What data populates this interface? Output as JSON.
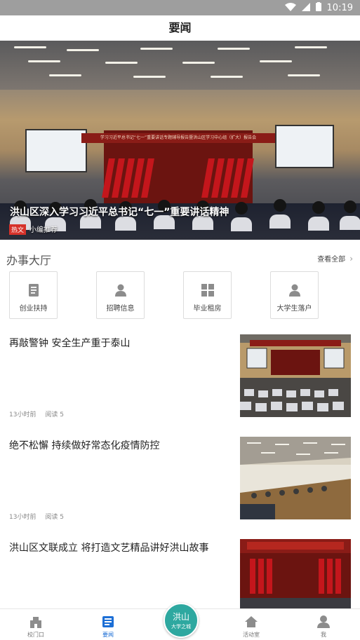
{
  "status_bar": {
    "time": "10:19"
  },
  "header": {
    "title": "要闻"
  },
  "banner": {
    "headline": "洪山区深入学习习近平总书记“七一”重要讲话精神",
    "tag": "热文",
    "source": "小编推荐",
    "stage_banner_text": "学习习近平总书记“七一”重要讲话专题辅导报告暨洪山区学习中心组（扩大）报告会"
  },
  "service_hall": {
    "title": "办事大厅",
    "view_all": "查看全部",
    "items": [
      {
        "label": "创业扶持",
        "icon": "document-icon"
      },
      {
        "label": "招聘信息",
        "icon": "person-icon"
      },
      {
        "label": "毕业租房",
        "icon": "grid-icon"
      },
      {
        "label": "大学生落户",
        "icon": "person-icon"
      }
    ]
  },
  "news": [
    {
      "title": "再敲警钟 安全生产重于泰山",
      "time": "13小时前",
      "reads": "阅读 5"
    },
    {
      "title": "绝不松懈 持续做好常态化疫情防控",
      "time": "13小时前",
      "reads": "阅读 5"
    },
    {
      "title": "洪山区文联成立 将打造文艺精品讲好洪山故事",
      "time": "",
      "reads": ""
    }
  ],
  "bottom_nav": {
    "tabs": [
      {
        "label": "校门口",
        "icon": "gate-icon"
      },
      {
        "label": "要闻",
        "icon": "newspaper-icon"
      },
      {
        "label": "活动室",
        "icon": "home-icon"
      },
      {
        "label": "我",
        "icon": "user-icon"
      }
    ],
    "center": {
      "line1": "洪山",
      "line2": "大学之城"
    }
  },
  "colors": {
    "accent": "#1d6fd6",
    "tag_red": "#d6322a",
    "center_teal": "#2ea8a0"
  }
}
